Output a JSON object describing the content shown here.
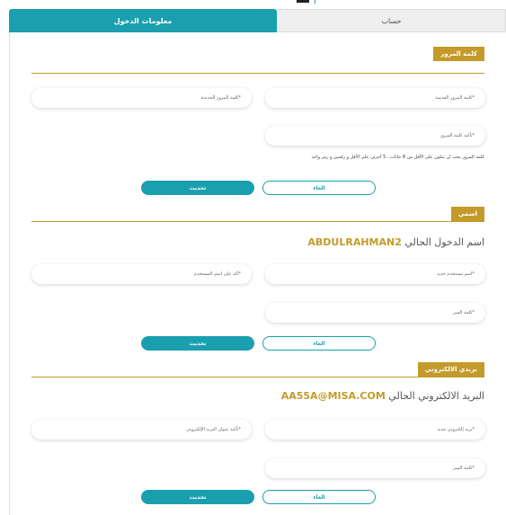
{
  "tabs": {
    "account": "حساب",
    "login_info": "معلومات الدخول"
  },
  "password": {
    "title": "كلمة المرور",
    "old_label": "كلمة المرور القديمة",
    "new_label": "كلمة المرور الجديدة",
    "confirm_label": "تأكيد كلمة المرور",
    "hint": "كلمة المرور يجب ان تتكون على الأقل من 8 خانات ، 5 أحرف على الأقل و رقمين و رمز واحد",
    "cancel": "الغاء",
    "update": "تحديث"
  },
  "username": {
    "title": "اسمي",
    "current_label": "اسم الدخول الحالي",
    "current_value": "ABDULRAHMAN2",
    "new_label": "اسم مستخدم جديد",
    "confirm_label": "أكد على اسم المستخدم",
    "password_label": "كلمة السر",
    "cancel": "الغاء",
    "update": "تحديث"
  },
  "email": {
    "title": "بريدي الالكتروني",
    "current_label": "البريد الالكتروني الحالي",
    "current_value": "AA55A@MISA.COM",
    "new_label": "بريد إلكتروني جديد",
    "confirm_label": "تأكيد عنوان البريد الإلكتروني",
    "password_label": "كلمة السر",
    "cancel": "الغاء",
    "update": "تحديث"
  },
  "required_mark": "*",
  "colors": {
    "teal": "#1a9fae",
    "gold": "#c49a2a"
  }
}
